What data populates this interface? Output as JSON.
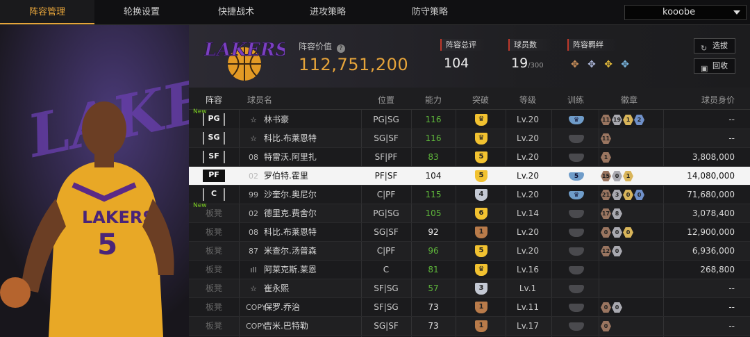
{
  "tabs": [
    {
      "label": "阵容管理",
      "active": true
    },
    {
      "label": "轮换设置",
      "active": false
    },
    {
      "label": "快捷战术",
      "active": false
    },
    {
      "label": "进攻策略",
      "active": false
    },
    {
      "label": "防守策略",
      "active": false
    }
  ],
  "user": {
    "name": "kooobe"
  },
  "team_logo_text": "LAKERS",
  "summary": {
    "value_label": "阵容价值",
    "value": "112,751,200",
    "rating_label": "阵容总评",
    "rating": "104",
    "players_label": "球员数",
    "players": "19",
    "players_max": "/300",
    "bond_label": "阵容羁绊"
  },
  "buttons": {
    "pick": "选拔",
    "recycle": "回收"
  },
  "columns": [
    "阵容",
    "球员名",
    "位置",
    "能力",
    "突破",
    "等级",
    "训练",
    "徽章",
    "球员身价"
  ],
  "colors": {
    "accent": "#e6a43a",
    "ability_up": "#5fb83b",
    "new_tag": "#7ed321"
  },
  "rows": [
    {
      "slot": "PG",
      "bench": false,
      "new": "New",
      "icon": "☆",
      "name": "林书豪",
      "position": "PG|SG",
      "ability": "116",
      "ability_up": true,
      "breakthrough": "♛",
      "breakthrough_tier": "gold",
      "level": "Lv.20",
      "training": "♛",
      "badges": [
        "11",
        "19",
        "1",
        "2"
      ],
      "value": "--"
    },
    {
      "slot": "SG",
      "bench": false,
      "new": "",
      "icon": "☆",
      "name": "科比.布莱恩特",
      "position": "SG|SF",
      "ability": "116",
      "ability_up": true,
      "breakthrough": "♛",
      "breakthrough_tier": "gold",
      "level": "Lv.20",
      "training": "",
      "badges": [
        "11"
      ],
      "value": "--"
    },
    {
      "slot": "SF",
      "bench": false,
      "new": "",
      "icon": "08",
      "name": "特雷沃.阿里扎",
      "position": "SF|PF",
      "ability": "83",
      "ability_up": true,
      "breakthrough": "5",
      "breakthrough_tier": "gold",
      "level": "Lv.20",
      "training": "",
      "badges": [
        "1"
      ],
      "value": "3,808,000"
    },
    {
      "slot": "PF",
      "bench": false,
      "new": "",
      "icon": "02",
      "name": "罗伯特.霍里",
      "position": "PF|SF",
      "ability": "104",
      "ability_up": false,
      "breakthrough": "5",
      "breakthrough_tier": "gold",
      "level": "Lv.20",
      "training": "5",
      "badges": [
        "15",
        "0",
        "1"
      ],
      "value": "14,080,000",
      "selected": true
    },
    {
      "slot": "C",
      "bench": false,
      "new": "",
      "icon": "99",
      "name": "沙奎尔.奥尼尔",
      "position": "C|PF",
      "ability": "115",
      "ability_up": true,
      "breakthrough": "4",
      "breakthrough_tier": "silver",
      "level": "Lv.20",
      "training": "♛",
      "badges": [
        "21",
        "3",
        "0",
        "0"
      ],
      "value": "71,680,000"
    },
    {
      "slot": "板凳",
      "bench": true,
      "new": "New",
      "icon": "02",
      "name": "德里克.费舍尔",
      "position": "PG|SG",
      "ability": "105",
      "ability_up": true,
      "breakthrough": "6",
      "breakthrough_tier": "gold",
      "level": "Lv.14",
      "training": "",
      "badges": [
        "17",
        "8"
      ],
      "value": "3,078,400"
    },
    {
      "slot": "板凳",
      "bench": true,
      "new": "",
      "icon": "08",
      "name": "科比.布莱恩特",
      "position": "SG|SF",
      "ability": "92",
      "ability_up": false,
      "breakthrough": "1",
      "breakthrough_tier": "bronze",
      "level": "Lv.20",
      "training": "",
      "badges": [
        "0",
        "0",
        "0"
      ],
      "value": "12,900,000"
    },
    {
      "slot": "板凳",
      "bench": true,
      "new": "",
      "icon": "87",
      "name": "米查尔.汤普森",
      "position": "C|PF",
      "ability": "96",
      "ability_up": true,
      "breakthrough": "5",
      "breakthrough_tier": "gold",
      "level": "Lv.20",
      "training": "",
      "badges": [
        "12",
        "0"
      ],
      "value": "6,936,000"
    },
    {
      "slot": "板凳",
      "bench": true,
      "new": "",
      "icon": "ıll",
      "name": "阿莱克斯.莱恩",
      "position": "C",
      "ability": "81",
      "ability_up": true,
      "breakthrough": "♛",
      "breakthrough_tier": "gold",
      "level": "Lv.16",
      "training": "",
      "badges": [],
      "value": "268,800"
    },
    {
      "slot": "板凳",
      "bench": true,
      "new": "",
      "icon": "☆",
      "name": "崔永熙",
      "position": "SF|SG",
      "ability": "57",
      "ability_up": true,
      "breakthrough": "3",
      "breakthrough_tier": "silver",
      "level": "Lv.1",
      "training": "",
      "badges": [],
      "value": "--"
    },
    {
      "slot": "板凳",
      "bench": true,
      "new": "",
      "icon": "COPY",
      "name": "保罗.乔治",
      "position": "SF|SG",
      "ability": "73",
      "ability_up": false,
      "breakthrough": "1",
      "breakthrough_tier": "bronze",
      "level": "Lv.11",
      "training": "",
      "badges": [
        "0",
        "0"
      ],
      "value": "--"
    },
    {
      "slot": "板凳",
      "bench": true,
      "new": "",
      "icon": "COPY",
      "name": "吉米.巴特勒",
      "position": "SG|SF",
      "ability": "73",
      "ability_up": false,
      "breakthrough": "1",
      "breakthrough_tier": "bronze",
      "level": "Lv.17",
      "training": "",
      "badges": [
        "0"
      ],
      "value": "--"
    }
  ]
}
